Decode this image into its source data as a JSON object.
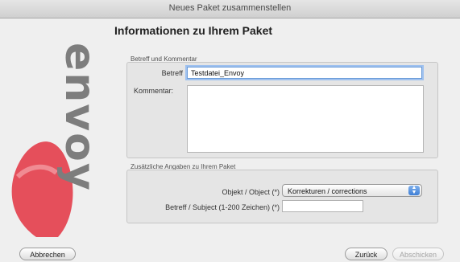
{
  "window": {
    "title": "Neues Paket zusammenstellen"
  },
  "brand": {
    "logo_text": "envoy"
  },
  "page": {
    "heading": "Informationen zu Ihrem Paket"
  },
  "group1": {
    "label": "Betreff und Kommentar",
    "subject_label": "Betreff",
    "subject_value": "Testdatei_Envoy",
    "comment_label": "Kommentar:",
    "comment_value": ""
  },
  "group2": {
    "label": "Zusätzliche Angaben zu Ihrem Paket",
    "object_label": "Objekt / Object (*)",
    "object_selected": "Korrekturen / corrections",
    "subject_label": "Betreff / Subject (1-200 Zeichen) (*)",
    "subject_value": ""
  },
  "buttons": {
    "cancel": "Abbrechen",
    "back": "Zurück",
    "send": "Abschicken"
  },
  "colors": {
    "accent": "#6a9bd8",
    "brand_red": "#e33d4a",
    "brand_gray": "#7d7d7d"
  }
}
